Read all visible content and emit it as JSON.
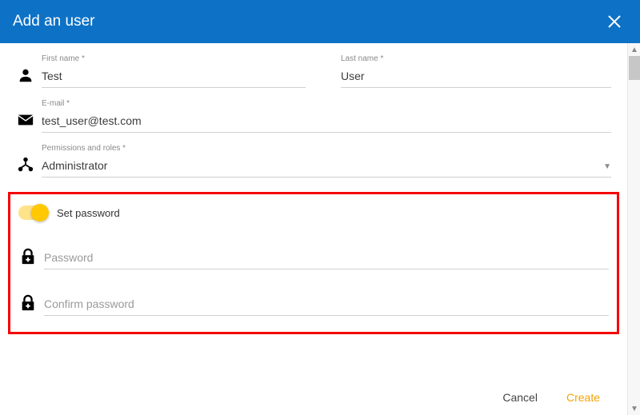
{
  "header": {
    "title": "Add an user"
  },
  "fields": {
    "first_name": {
      "label": "First name *",
      "value": "Test"
    },
    "last_name": {
      "label": "Last name *",
      "value": "User"
    },
    "email": {
      "label": "E-mail *",
      "value": "test_user@test.com"
    },
    "permissions": {
      "label": "Permissions and roles *",
      "value": "Administrator"
    },
    "set_password": {
      "label": "Set password",
      "on": true
    },
    "password": {
      "placeholder": "Password"
    },
    "confirm_password": {
      "placeholder": "Confirm password"
    }
  },
  "footer": {
    "cancel": "Cancel",
    "create": "Create"
  }
}
